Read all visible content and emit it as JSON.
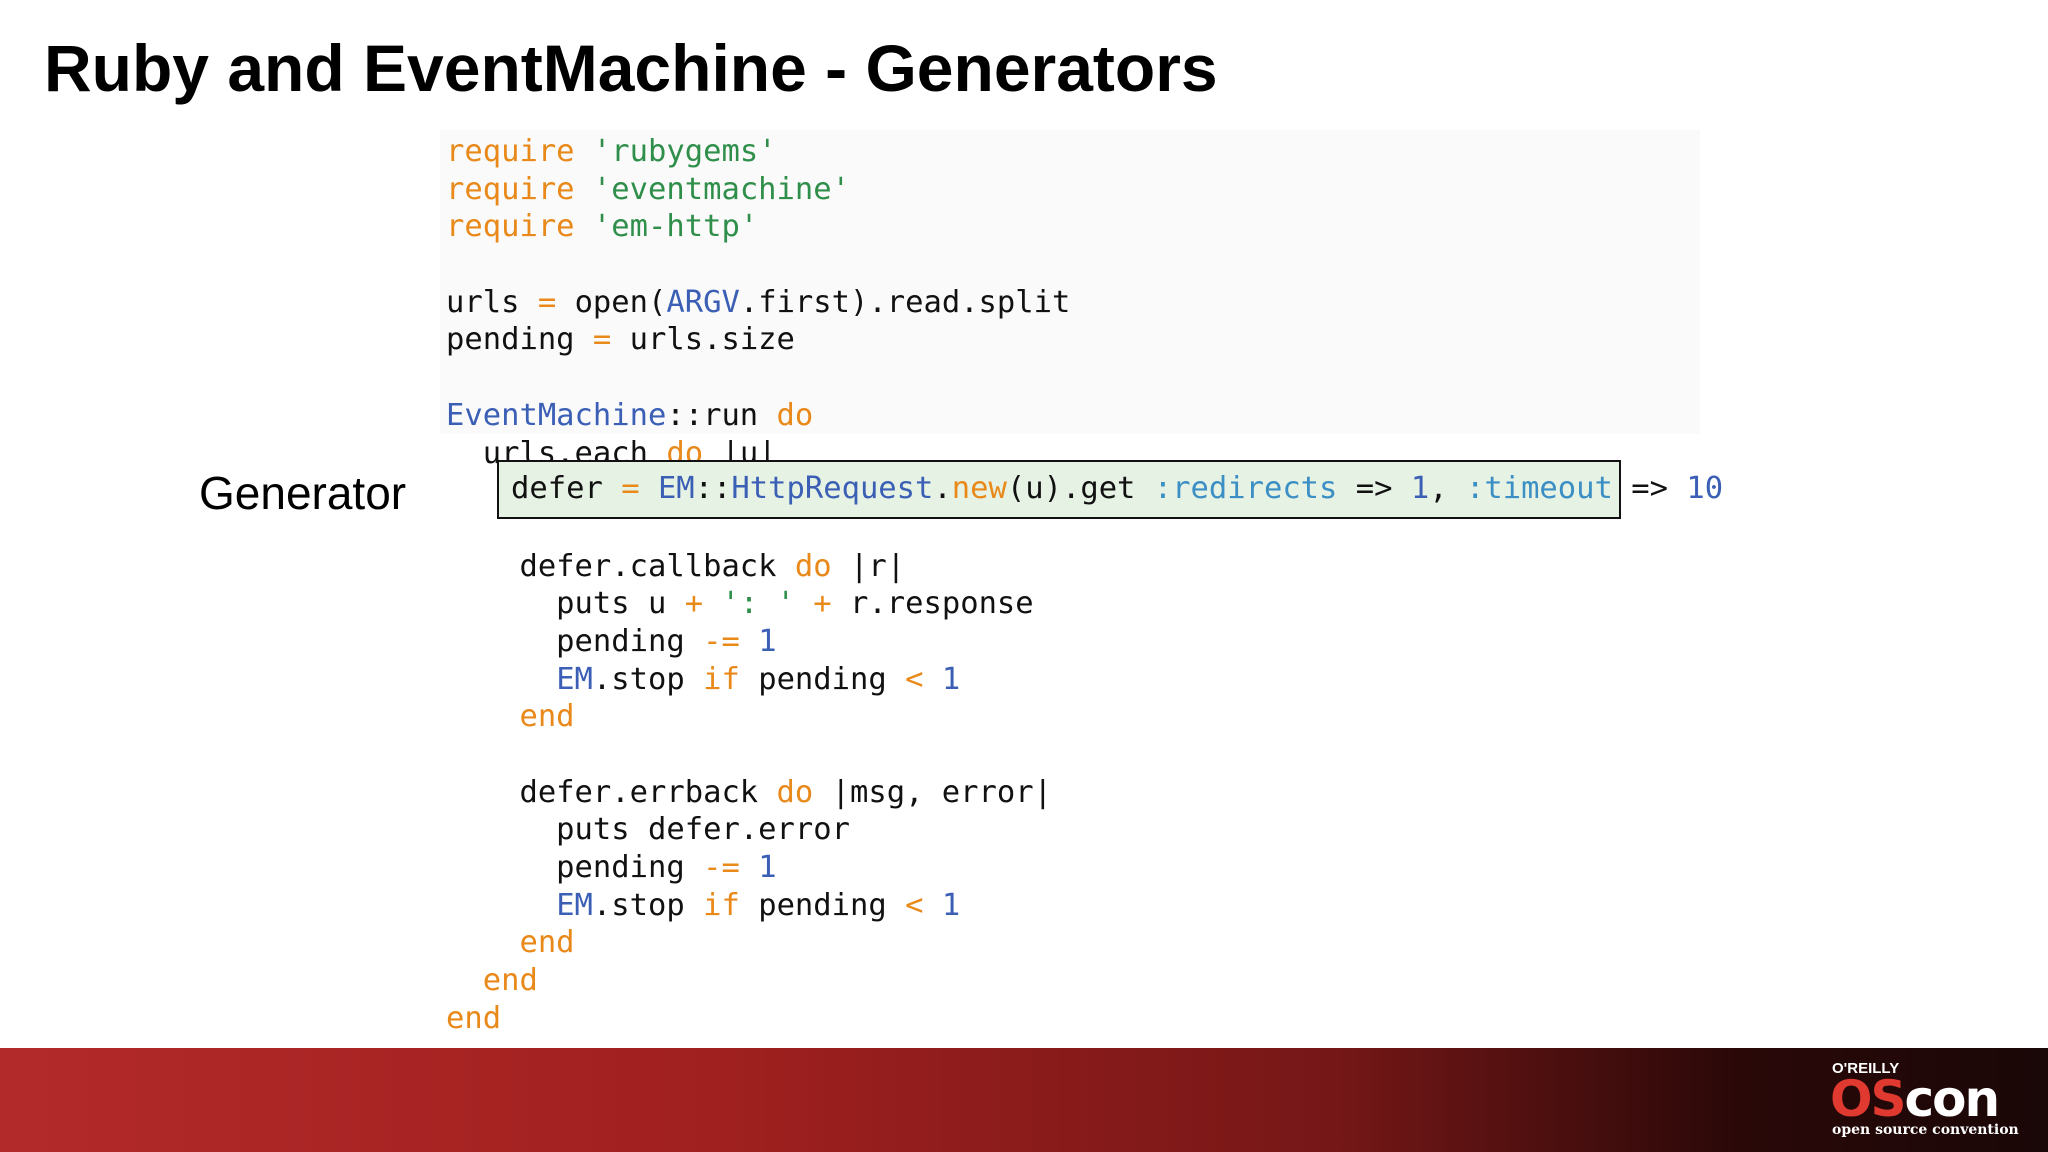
{
  "slide": {
    "title": "Ruby and EventMachine - Generators",
    "side_label": "Generator"
  },
  "code": {
    "lines": [
      [
        {
          "t": "require",
          "c": "kw"
        },
        {
          "t": " "
        },
        {
          "t": "'rubygems'",
          "c": "str"
        }
      ],
      [
        {
          "t": "require",
          "c": "kw"
        },
        {
          "t": " "
        },
        {
          "t": "'eventmachine'",
          "c": "str"
        }
      ],
      [
        {
          "t": "require",
          "c": "kw"
        },
        {
          "t": " "
        },
        {
          "t": "'em-http'",
          "c": "str"
        }
      ],
      [],
      [
        {
          "t": "urls "
        },
        {
          "t": "=",
          "c": "kw"
        },
        {
          "t": " open("
        },
        {
          "t": "ARGV",
          "c": "cst"
        },
        {
          "t": ".first).read.split"
        }
      ],
      [
        {
          "t": "pending "
        },
        {
          "t": "=",
          "c": "kw"
        },
        {
          "t": " urls.size"
        }
      ],
      [],
      [
        {
          "t": "EventMachine",
          "c": "cst"
        },
        {
          "t": "::run "
        },
        {
          "t": "do",
          "c": "kw"
        }
      ],
      [
        {
          "t": "  urls.each "
        },
        {
          "t": "do",
          "c": "kw"
        },
        {
          "t": " |u|"
        }
      ],
      [],
      [],
      [
        {
          "t": "    defer.callback "
        },
        {
          "t": "do",
          "c": "kw"
        },
        {
          "t": " |r|"
        }
      ],
      [
        {
          "t": "      puts u "
        },
        {
          "t": "+",
          "c": "kw"
        },
        {
          "t": " "
        },
        {
          "t": "': '",
          "c": "str"
        },
        {
          "t": " "
        },
        {
          "t": "+",
          "c": "kw"
        },
        {
          "t": " r.response"
        }
      ],
      [
        {
          "t": "      pending "
        },
        {
          "t": "-=",
          "c": "kw"
        },
        {
          "t": " "
        },
        {
          "t": "1",
          "c": "num"
        }
      ],
      [
        {
          "t": "      "
        },
        {
          "t": "EM",
          "c": "cst"
        },
        {
          "t": ".stop "
        },
        {
          "t": "if",
          "c": "kw"
        },
        {
          "t": " pending "
        },
        {
          "t": "<",
          "c": "kw"
        },
        {
          "t": " "
        },
        {
          "t": "1",
          "c": "num"
        }
      ],
      [
        {
          "t": "    "
        },
        {
          "t": "end",
          "c": "kw"
        }
      ],
      [],
      [
        {
          "t": "    defer.errback "
        },
        {
          "t": "do",
          "c": "kw"
        },
        {
          "t": " |msg, error|"
        }
      ],
      [
        {
          "t": "      puts defer.error"
        }
      ],
      [
        {
          "t": "      pending "
        },
        {
          "t": "-=",
          "c": "kw"
        },
        {
          "t": " "
        },
        {
          "t": "1",
          "c": "num"
        }
      ],
      [
        {
          "t": "      "
        },
        {
          "t": "EM",
          "c": "cst"
        },
        {
          "t": ".stop "
        },
        {
          "t": "if",
          "c": "kw"
        },
        {
          "t": " pending "
        },
        {
          "t": "<",
          "c": "kw"
        },
        {
          "t": " "
        },
        {
          "t": "1",
          "c": "num"
        }
      ],
      [
        {
          "t": "    "
        },
        {
          "t": "end",
          "c": "kw"
        }
      ],
      [
        {
          "t": "  "
        },
        {
          "t": "end",
          "c": "kw"
        }
      ],
      [
        {
          "t": "end",
          "c": "kw"
        }
      ]
    ],
    "highlighted_line": [
      {
        "t": "defer "
      },
      {
        "t": "=",
        "c": "kw"
      },
      {
        "t": " "
      },
      {
        "t": "EM",
        "c": "cst"
      },
      {
        "t": "::"
      },
      {
        "t": "HttpRequest",
        "c": "cst"
      },
      {
        "t": "."
      },
      {
        "t": "new",
        "c": "kw"
      },
      {
        "t": "(u).get "
      },
      {
        "t": ":redirects",
        "c": "sym"
      },
      {
        "t": " => "
      },
      {
        "t": "1",
        "c": "num"
      },
      {
        "t": ", "
      },
      {
        "t": ":timeout",
        "c": "sym"
      },
      {
        "t": " => "
      },
      {
        "t": "10",
        "c": "num"
      }
    ]
  },
  "footer": {
    "logo_top": "O'REILLY",
    "logo_os": "OS",
    "logo_con": "con",
    "logo_sub": "open source convention"
  }
}
